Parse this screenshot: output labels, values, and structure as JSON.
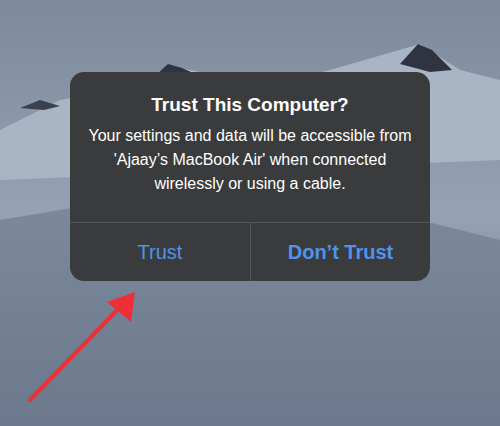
{
  "alert": {
    "title": "Trust This Computer?",
    "message": "Your settings and data will be accessible from 'Ajaay’s MacBook Air' when connected wirelessly or using a cable.",
    "buttons": [
      {
        "label": "Trust",
        "default": false,
        "highlighted": true
      },
      {
        "label": "Don’t Trust",
        "default": true,
        "highlighted": false
      }
    ]
  }
}
